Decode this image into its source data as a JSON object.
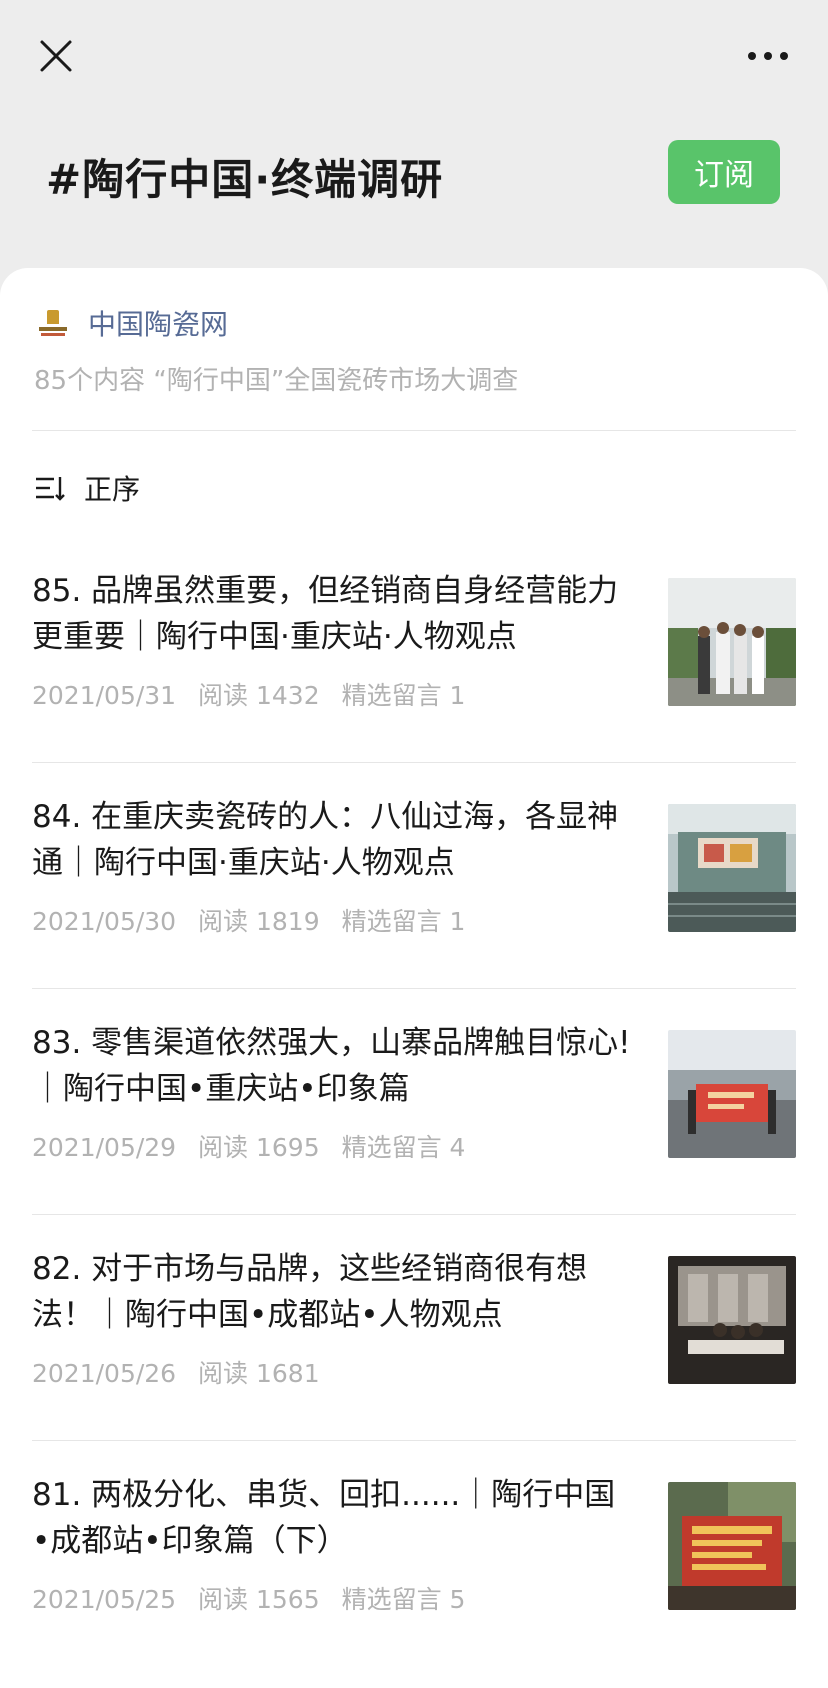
{
  "window": {
    "close_icon": "close-icon",
    "more_icon": "more-icon"
  },
  "header": {
    "title": "#陶行中国·终端调研",
    "subscribe_label": "订阅",
    "subscribe_color": "#59c46a"
  },
  "account": {
    "name": "中国陶瓷网",
    "description": "85个内容 “陶行中国”全国瓷砖市场大调查",
    "logo_icon": "account-logo-icon"
  },
  "sort": {
    "label": "正序",
    "icon": "sort-order-icon"
  },
  "articles": [
    {
      "title": "85. 品牌虽然重要，但经销商自身经营能力更重要｜陶行中国·重庆站·人物观点",
      "date": "2021/05/31",
      "reads": "阅读 1432",
      "comments": "精选留言 1"
    },
    {
      "title": "84. 在重庆卖瓷砖的人：八仙过海，各显神通｜陶行中国·重庆站·人物观点",
      "date": "2021/05/30",
      "reads": "阅读 1819",
      "comments": "精选留言 1"
    },
    {
      "title": "83. 零售渠道依然强大，山寨品牌触目惊心!｜陶行中国•重庆站•印象篇",
      "date": "2021/05/29",
      "reads": "阅读 1695",
      "comments": "精选留言 4"
    },
    {
      "title": "82. 对于市场与品牌，这些经销商很有想法！｜陶行中国•成都站•人物观点",
      "date": "2021/05/26",
      "reads": "阅读 1681",
      "comments": ""
    },
    {
      "title": "81. 两极分化、串货、回扣......｜陶行中国•成都站•印象篇（下）",
      "date": "2021/05/25",
      "reads": "阅读 1565",
      "comments": "精选留言 5"
    }
  ]
}
